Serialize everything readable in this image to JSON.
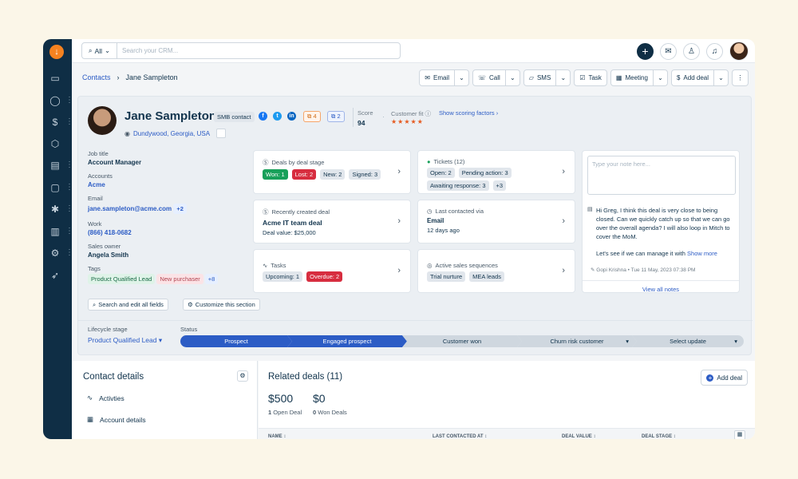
{
  "topbar": {
    "search_scope": "All",
    "search_placeholder": "Search your CRM..."
  },
  "breadcrumb": {
    "parent": "Contacts",
    "current": "Jane Sampleton"
  },
  "actions": [
    "Email",
    "Call",
    "SMS",
    "Task",
    "Meeting",
    "Add deal"
  ],
  "contact": {
    "name": "Jane Sampleton",
    "segment": "SMB contact",
    "pill_orange": "4",
    "pill_blue": "2",
    "location": "Dundywood, Georgia, USA",
    "score_label": "Score",
    "score": "94",
    "fit_label": "Customer fit",
    "fit_stars": "★★★★★",
    "scoring_link": "Show scoring factors"
  },
  "fields": {
    "job_title_label": "Job title",
    "job_title": "Account Manager",
    "accounts_label": "Accounts",
    "accounts": "Acme",
    "email_label": "Email",
    "email": "jane.sampleton@acme.com",
    "email_more": "+2",
    "work_label": "Work",
    "work": "(866) 418-0682",
    "owner_label": "Sales owner",
    "owner": "Angela Smith",
    "tags_label": "Tags",
    "tag1": "Product Qualified Lead",
    "tag2": "New purchaser",
    "tag_more": "+8",
    "search_btn": "Search and edit all fields",
    "customize_btn": "Customize this section"
  },
  "tiles": {
    "deals_title": "Deals by deal stage",
    "won": "Won: 1",
    "lost": "Lost: 2",
    "new": "New: 2",
    "signed": "Signed: 3",
    "tickets_title": "Tickets (12)",
    "open": "Open: 2",
    "pending": "Pending action: 3",
    "awaiting": "Awaiting response: 3",
    "tickets_more": "+3",
    "recent_title": "Recently created deal",
    "recent_name": "Acme IT team deal",
    "recent_value": "Deal value: $25,000",
    "contacted_title": "Last contacted via",
    "contacted_via": "Email",
    "contacted_when": "12 days ago",
    "tasks_title": "Tasks",
    "upcoming": "Upcoming: 1",
    "overdue": "Overdue: 2",
    "seq_title": "Active sales sequences",
    "seq1": "Trial nurture",
    "seq2": "MEA leads"
  },
  "notes": {
    "placeholder": "Type your note here...",
    "text": "Hi Greg, I think this deal is very close to being closed. Can we quickly catch up so that we can go over the overall agenda? I will also loop in Mitch to cover the MoM.",
    "text2": "Let's see if we can manage it with",
    "show_more": "Show more",
    "author": "Gopi Krishna",
    "date": "Tue 11 May, 2023 07:38 PM",
    "view_all": "View all notes"
  },
  "stage": {
    "lifecycle_label": "Lifecycle stage",
    "lifecycle_value": "Product Qualified Lead",
    "status_label": "Status",
    "steps": [
      "Prospect",
      "Engaged prospect",
      "Customer won",
      "Churn risk customer",
      "Select update"
    ]
  },
  "contact_details": {
    "title": "Contact details",
    "items": [
      "Activties",
      "Account details"
    ]
  },
  "related": {
    "title": "Related deals (11)",
    "add_btn": "Add deal",
    "open_amount": "$500",
    "open_count": "1",
    "open_label": "Open Deal",
    "won_amount": "$0",
    "won_count": "0",
    "won_label": "Won Deals",
    "columns": [
      "NAME",
      "LAST CONTACTED AT",
      "DEAL VALUE",
      "DEAL STAGE"
    ]
  },
  "colors": {
    "rail": "#0f2e45",
    "accent": "#2c5cc5",
    "won": "#18a05a",
    "lost": "#d72d3f",
    "brand": "#f58220"
  }
}
